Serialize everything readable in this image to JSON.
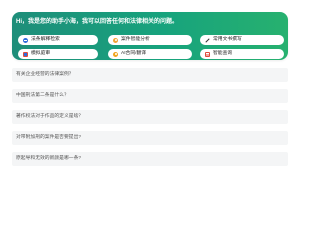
{
  "header": {
    "greeting": "Hi，我是您的助手小海，我可以回答任何和法律相关的问题。"
  },
  "quick_actions": [
    {
      "label": "法条解释检索",
      "icon": "law-book-icon"
    },
    {
      "label": "案件智能分析",
      "icon": "case-analysis-icon"
    },
    {
      "label": "常用文书撰写",
      "icon": "pen-icon"
    },
    {
      "label": "模拟庭审",
      "icon": "courtroom-icon"
    },
    {
      "label": "AI合同/翻译",
      "icon": "ai-contract-icon"
    },
    {
      "label": "智能查询",
      "icon": "document-search-icon"
    }
  ],
  "suggested_questions": [
    "有关企业经营的法律案例？",
    "中国刑法第二条是什么？",
    "著作权法对于作品的定义是啥？",
    "对带附加刑的案件是否要提出?",
    "原起导和无效的新颜是哪一条?"
  ]
}
